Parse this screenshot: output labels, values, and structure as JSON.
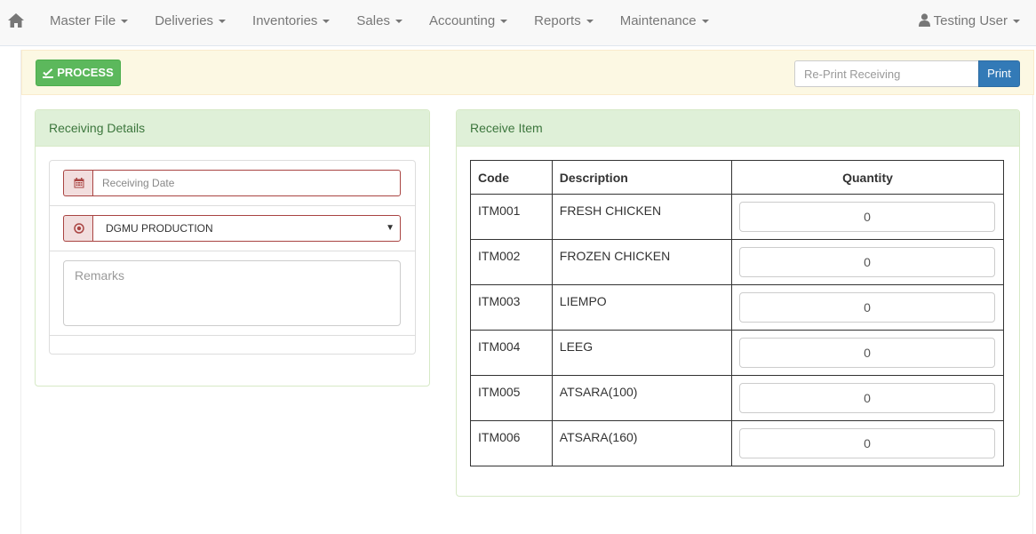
{
  "nav": {
    "home_icon": "home-icon",
    "menus": [
      {
        "label": "Master File"
      },
      {
        "label": "Deliveries"
      },
      {
        "label": "Inventories"
      },
      {
        "label": "Sales"
      },
      {
        "label": "Accounting"
      },
      {
        "label": "Reports"
      },
      {
        "label": "Maintenance"
      }
    ],
    "user": {
      "label": "Testing User",
      "icon": "user-icon"
    }
  },
  "toolbar": {
    "process_label": "PROCESS",
    "reprint_placeholder": "Re-Print Receiving",
    "print_label": "Print"
  },
  "receiving_details": {
    "title": "Receiving Details",
    "date_placeholder": "Receiving Date",
    "date_icon": "calendar-icon",
    "source_icon": "dot-circle-icon",
    "source_value": "DGMU PRODUCTION",
    "remarks_placeholder": "Remarks"
  },
  "receive_item": {
    "title": "Receive Item",
    "columns": {
      "code": "Code",
      "description": "Description",
      "quantity": "Quantity"
    },
    "rows": [
      {
        "code": "ITM001",
        "description": "FRESH CHICKEN",
        "quantity": "0"
      },
      {
        "code": "ITM002",
        "description": "FROZEN CHICKEN",
        "quantity": "0"
      },
      {
        "code": "ITM003",
        "description": "LIEMPO",
        "quantity": "0"
      },
      {
        "code": "ITM004",
        "description": "LEEG",
        "quantity": "0"
      },
      {
        "code": "ITM005",
        "description": "ATSARA(100)",
        "quantity": "0"
      },
      {
        "code": "ITM006",
        "description": "ATSARA(160)",
        "quantity": "0"
      }
    ]
  },
  "colors": {
    "success": "#5cb85c",
    "primary": "#337ab7",
    "panel_heading_bg": "#dff0d8",
    "panel_heading_text": "#3c763d",
    "error_border": "#a94442",
    "toolbar_bg": "#fcf8e3"
  }
}
